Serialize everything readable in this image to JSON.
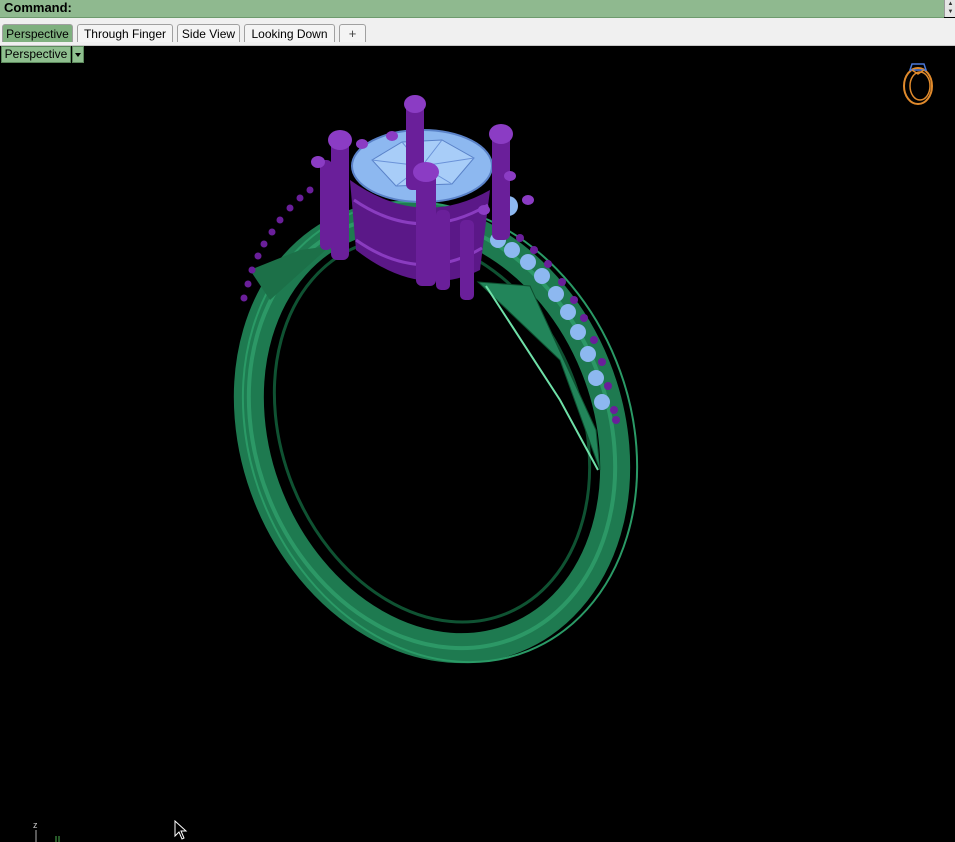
{
  "command_bar": {
    "label": "Command:"
  },
  "tabs": [
    {
      "label": "Perspective",
      "active": true
    },
    {
      "label": "Through Finger",
      "active": false
    },
    {
      "label": "Side View",
      "active": false
    },
    {
      "label": "Looking Down",
      "active": false
    }
  ],
  "add_tab_glyph": "+",
  "viewport": {
    "title": "Perspective"
  },
  "axis_labels": {
    "z": "z"
  },
  "colors": {
    "command_bar": "#8fb98f",
    "active_tab": "#7fb07f",
    "ring_band": "#1f7a4f",
    "prongs": "#6a1f9a",
    "gem": "#8db8f0",
    "background": "#000000"
  },
  "icons": [
    "ring-preview-icon",
    "mouse-cursor-icon",
    "axis-gizmo-icon",
    "dropdown-arrow-icon",
    "add-tab-icon"
  ]
}
